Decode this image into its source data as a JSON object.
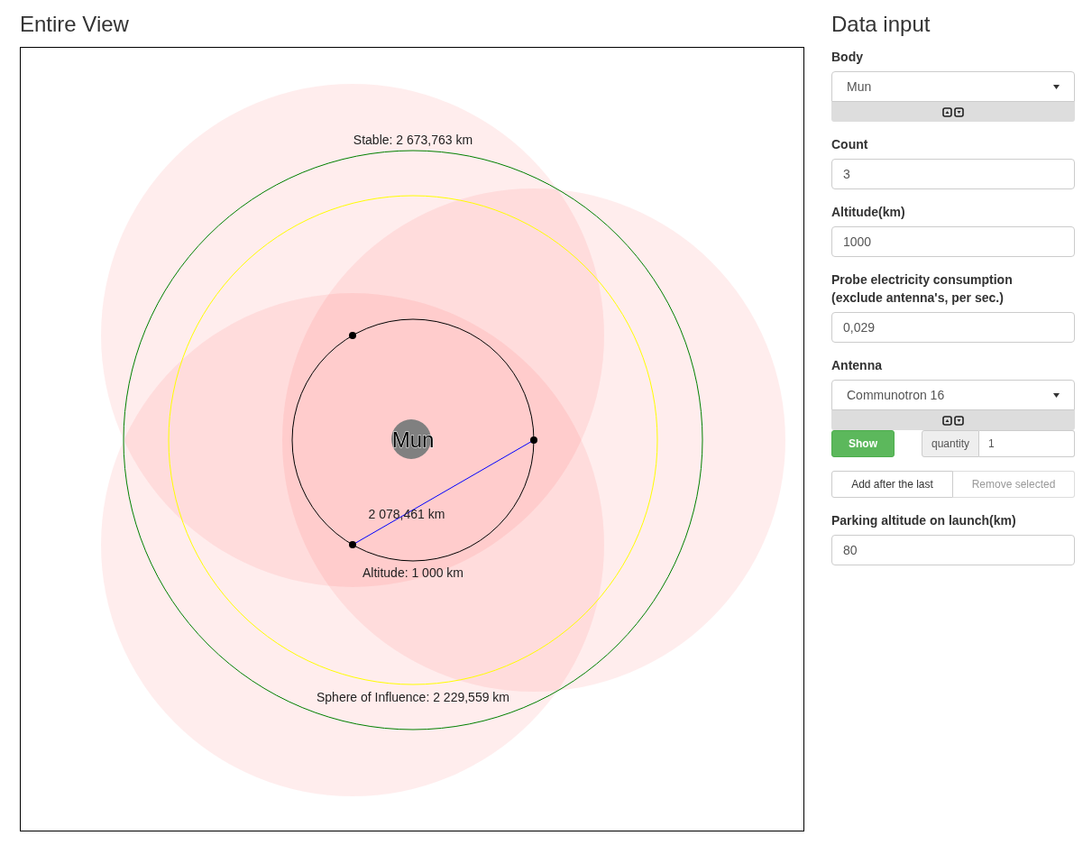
{
  "view": {
    "title": "Entire View"
  },
  "diagram": {
    "body": "Mun",
    "stable_label": "Stable: 2 673,763 km",
    "soi_label": "Sphere of Influence: 2 229,559 km",
    "distance_label": "2 078,461 km",
    "altitude_label": "Altitude: 1 000 km"
  },
  "panel": {
    "title": "Data input",
    "items": [
      {
        "kind": "select",
        "label": "Body",
        "value": "Mun"
      },
      {
        "kind": "text",
        "label": "Count",
        "value": "3"
      },
      {
        "kind": "text",
        "label": "Altitude(km)",
        "value": "1000"
      },
      {
        "kind": "text",
        "label": "Probe electricity consumption (exclude antenna's, per sec.)",
        "value": "0,029"
      },
      {
        "kind": "select",
        "label": "Antenna",
        "value": "Communotron 16"
      },
      {
        "kind": "show-quantity",
        "button": "Show",
        "addon": "quantity",
        "value": "1"
      },
      {
        "kind": "button-group",
        "buttons": [
          {
            "label": "Add after the last",
            "disabled": false
          },
          {
            "label": "Remove selected",
            "disabled": true
          }
        ]
      },
      {
        "kind": "text",
        "label": "Parking altitude on launch(km)",
        "value": "80"
      }
    ]
  }
}
